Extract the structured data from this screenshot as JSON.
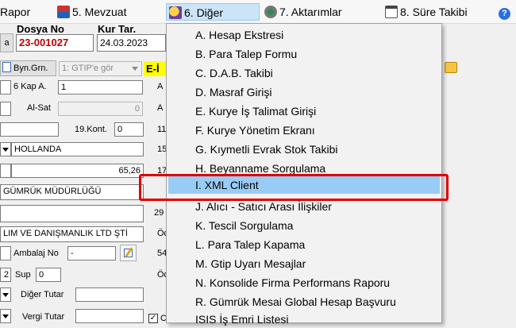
{
  "menubar": {
    "rapor": "Rapor",
    "mevzuat": "5.  Mevzuat",
    "diger": "6.  Diğer",
    "aktarimlar": "7.  Aktarımlar",
    "sure": "8. Süre Takibi",
    "help_glyph": "?"
  },
  "form": {
    "left_btn": "a",
    "dosya_no_label": "Dosya No",
    "dosya_no_value": "23-001027",
    "kur_tar_label": "Kur Tar.",
    "kur_tar_value": "24.03.2023",
    "byn_grn": "Byn.Grn.",
    "gtip_select": "1: GTIP'e gör",
    "e_label": "E-İ",
    "kap_label": "6 Kap A.",
    "kap_value": "1",
    "al_sat_label": "Al-Sat",
    "al_sat_value": "0",
    "kont_label": "19.Kont.",
    "kont_value": "0",
    "country_value": "HOLLANDA",
    "amount_value": "65,26",
    "customs_value": "GÜMRÜK MÜDÜRLÜĞÜ",
    "company_value": "LIM VE DANIŞMANLIK LTD ŞTİ",
    "ambalaj_label": "Ambalaj No",
    "ambalaj_value": "-",
    "two_value": "2",
    "sup_label": "Sup",
    "sup_value": "0",
    "diger_tutar_label": "Diğer Tutar",
    "vergi_tutar_label": "Vergi Tutar",
    "col_a1": "A",
    "col_a2": "A",
    "num_11": "11",
    "num_15": "15",
    "num_17": "17",
    "num_29": "29",
    "od1": "Öd",
    "num_54": "54",
    "od2": "Öd",
    "ch_c": "C"
  },
  "menu": {
    "items": [
      {
        "label": "A.   Hesap Ekstresi"
      },
      {
        "label": "B.   Para Talep Formu"
      },
      {
        "label": "C.   D.A.B. Takibi"
      },
      {
        "label": "D.   Masraf Girişi"
      },
      {
        "label": "E.   Kurye İş Talimat Girişi"
      },
      {
        "label": "F.   Kurye Yönetim Ekranı"
      },
      {
        "label": "G.   Kıymetli Evrak Stok Takibi"
      },
      {
        "label": "H.   Beyanname Sorgulama"
      },
      {
        "label": "I.   XML Client"
      },
      {
        "label": "J.   Alıcı - Satıcı Arası İlişkiler"
      },
      {
        "label": "K.  Tescil Sorgulama"
      },
      {
        "label": "L. Para Talep Kapama"
      },
      {
        "label": "M. Gtip Uyarı Mesajlar"
      },
      {
        "label": "N. Konsolide Firma Performans Raporu"
      },
      {
        "label": "R. Gümrük Mesai Global Hesap Başvuru"
      },
      {
        "label": "ISIS İş Emri Listesi"
      }
    ],
    "highlighted_index": 8
  },
  "colors": {
    "highlight": "#99ccf5",
    "annotation_red": "#e00000",
    "dosya_red": "#c00000",
    "e_yellow": "#ffff00"
  }
}
